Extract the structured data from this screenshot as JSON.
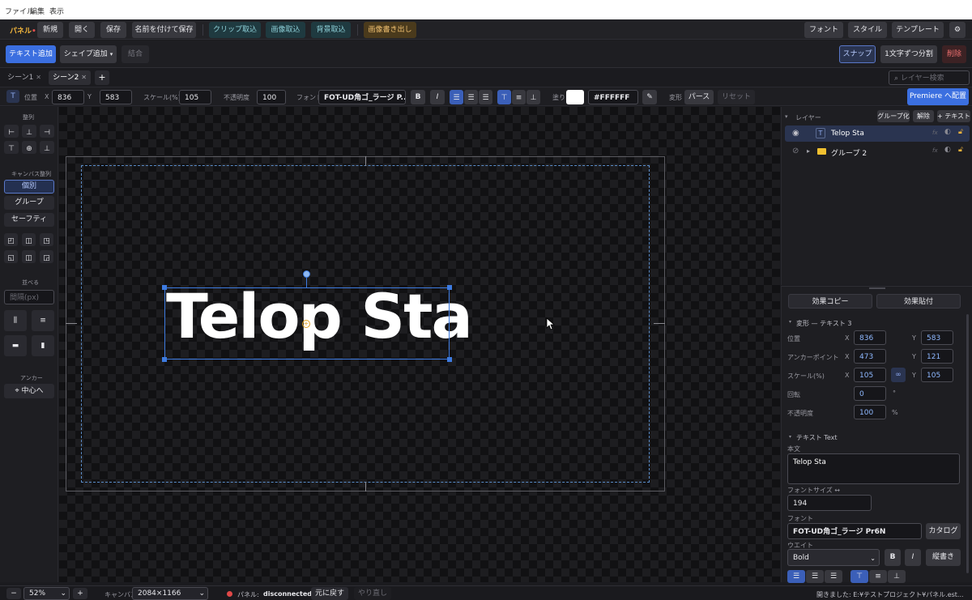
{
  "menubar": {
    "file": "ファイル",
    "edit": "編集",
    "view": "表示"
  },
  "toolbar": {
    "panel_label": "パネル",
    "panel_dot": "•",
    "new": "新規",
    "open": "開く",
    "save": "保存",
    "save_as": "名前を付けて保存",
    "clip_import": "クリップ取込",
    "image_import": "画像取込",
    "bg_import": "背景取込",
    "export_image": "画像書き出し",
    "font": "フォント",
    "style": "スタイル",
    "template": "テンプレート",
    "settings_glyph": "⚙"
  },
  "secondbar": {
    "add_text": "テキスト追加",
    "add_shape": "シェイプ追加",
    "combine": "結合",
    "snap": "スナップ",
    "split_chars": "1文字ずつ分割",
    "delete": "削除"
  },
  "tabs": [
    {
      "label": "シーン1"
    },
    {
      "label": "シーン2"
    }
  ],
  "tab_close_glyph": "✕",
  "add_tab_glyph": "+",
  "layer_search": {
    "placeholder": "レイヤー検索"
  },
  "props": {
    "type_icon": "T",
    "pos_label": "位置",
    "x_label": "X",
    "x": "836",
    "y_label": "Y",
    "y": "583",
    "scale_label": "スケール(%)",
    "scale": "105",
    "opacity_label": "不透明度",
    "opacity": "100",
    "font_label": "フォント",
    "font": "FOT-UD角ゴ_ラージ P...",
    "bold": "B",
    "italic": "I",
    "fill_label": "塗り",
    "fill_hex": "#FFFFFF",
    "fill_color": "#FFFFFF",
    "transform_label": "変形",
    "perspective": "パース",
    "reset": "リセット",
    "premiere": "Premiere へ配置"
  },
  "leftpanel": {
    "align_label": "整列",
    "canvas_align_label": "キャンバス整列",
    "individual": "個別",
    "group": "グループ",
    "safety": "セーフティ",
    "distribute_label": "並べる",
    "spacing_placeholder": "間隔(px)",
    "anchor_label": "アンカー",
    "center": "中心へ"
  },
  "canvas": {
    "text": "Telop Sta",
    "text_color": "#FFFFFF",
    "guide_color": "#5a8cc8"
  },
  "layers": {
    "title": "レイヤー",
    "group_btn": "グループ化",
    "ungroup_btn": "解除",
    "add_text_btn": "+ テキスト",
    "items": [
      {
        "type_glyph": "T",
        "name": "Telop Sta",
        "fx": "fx"
      },
      {
        "type_glyph": "▸",
        "name": "グループ 2",
        "fx": "fx"
      }
    ]
  },
  "inspector": {
    "copy_effect": "効果コピー",
    "paste_effect": "効果貼付",
    "transform_title": "変形 — テキスト 3",
    "pos_label": "位置",
    "pos_x": "836",
    "pos_y": "583",
    "anchor_label": "アンカーポイント",
    "anchor_x": "473",
    "anchor_y": "121",
    "scale_label": "スケール(%)",
    "scale_x": "105",
    "scale_y": "105",
    "rotation_label": "回転",
    "rotation": "0",
    "rotation_unit": "°",
    "opacity_label": "不透明度",
    "opacity": "100",
    "opacity_unit": "%",
    "x": "X",
    "y": "Y",
    "text_title": "テキスト Text",
    "body_label": "本文",
    "body_text": "Telop Sta",
    "fontsize_label": "フォントサイズ ↔",
    "fontsize": "194",
    "font_label": "フォント",
    "font": "FOT-UD角ゴ_ラージ Pr6N",
    "catalog": "カタログ",
    "weight_label": "ウエイト",
    "weight": "Bold",
    "bold": "B",
    "italic": "I",
    "vertical": "縦書き"
  },
  "statusbar": {
    "minus": "−",
    "zoom": "52%",
    "plus": "+",
    "canvas_label": "キャンバス",
    "canvas_size": "2084×1166",
    "panel_label": "パネル:",
    "panel_status": "disconnected",
    "undo": "元に戻す",
    "redo": "やり直し",
    "opened": "開きました: E:¥テストプロジェクト¥パネル.est..."
  }
}
